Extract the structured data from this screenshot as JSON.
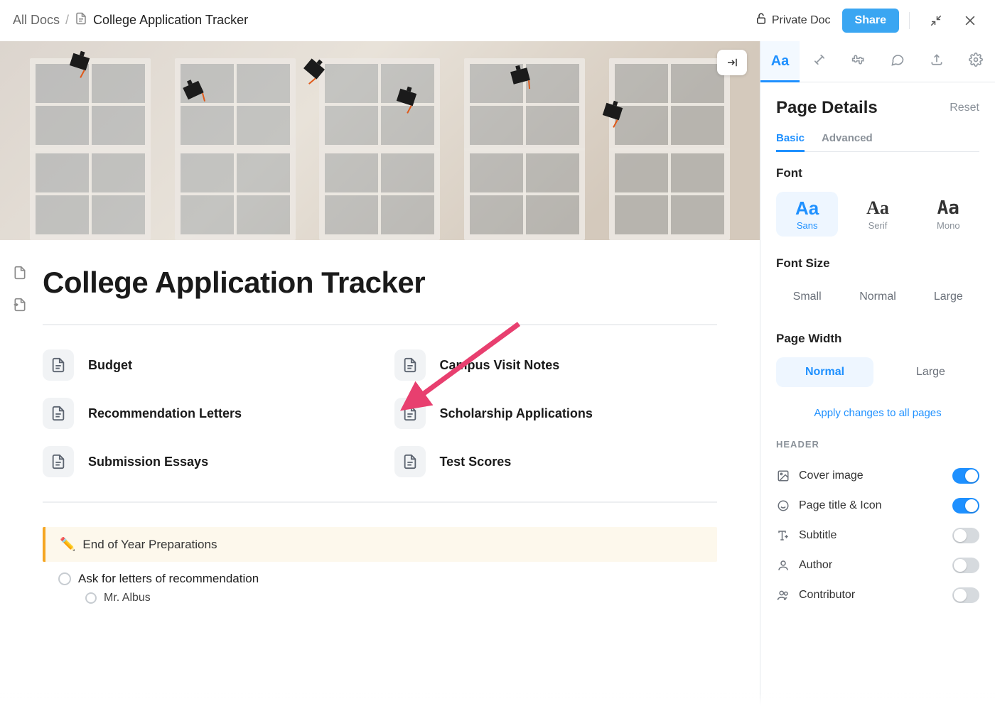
{
  "topbar": {
    "crumb_root": "All Docs",
    "crumb_title": "College Application Tracker",
    "privacy_label": "Private Doc",
    "share_label": "Share"
  },
  "document": {
    "title": "College Application Tracker",
    "linked_pages": [
      {
        "label": "Budget"
      },
      {
        "label": "Campus Visit Notes"
      },
      {
        "label": "Recommendation Letters"
      },
      {
        "label": "Scholarship Applications"
      },
      {
        "label": "Submission Essays"
      },
      {
        "label": "Test Scores"
      }
    ],
    "note": {
      "emoji": "✏️",
      "text": "End of Year Preparations"
    },
    "tasks": [
      {
        "text": "Ask for letters of recommendation",
        "subtasks": [
          {
            "text": "Mr. Albus"
          }
        ]
      }
    ]
  },
  "panel": {
    "title": "Page Details",
    "reset": "Reset",
    "sub_tabs": {
      "basic": "Basic",
      "advanced": "Advanced"
    },
    "font_section": "Font",
    "font_cards": {
      "sans": "Sans",
      "serif": "Serif",
      "mono": "Mono"
    },
    "font_size_section": "Font Size",
    "font_sizes": {
      "small": "Small",
      "normal": "Normal",
      "large": "Large"
    },
    "page_width_section": "Page Width",
    "page_widths": {
      "normal": "Normal",
      "large": "Large"
    },
    "apply_all": "Apply changes to all pages",
    "header_section": "HEADER",
    "header_items": [
      {
        "key": "cover",
        "label": "Cover image",
        "on": true,
        "icon": "image-icon"
      },
      {
        "key": "title",
        "label": "Page title & Icon",
        "on": true,
        "icon": "smiley-icon"
      },
      {
        "key": "subtitle",
        "label": "Subtitle",
        "on": false,
        "icon": "subtitle-icon"
      },
      {
        "key": "author",
        "label": "Author",
        "on": false,
        "icon": "person-icon"
      },
      {
        "key": "contributor",
        "label": "Contributor",
        "on": false,
        "icon": "people-icon"
      }
    ]
  }
}
